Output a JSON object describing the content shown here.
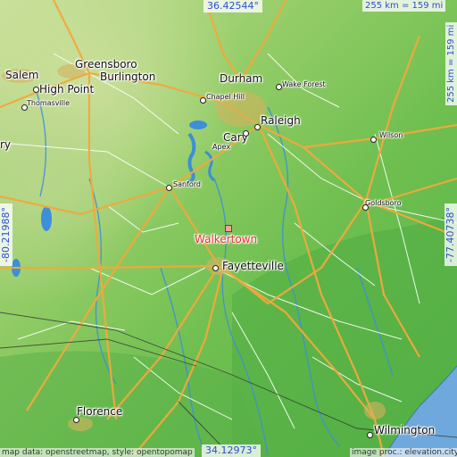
{
  "map": {
    "target": {
      "name": "Walkertown",
      "color": "#e8322a"
    },
    "coords": {
      "top": "36.42544°",
      "bottom": "34.12973°",
      "left": "-80.21988°",
      "right": "-77.40738°"
    },
    "scale": {
      "horizontal": "255 km = 159 mi",
      "vertical": "255 km = 159 mi"
    },
    "attribution": {
      "left": "map data: openstreetmap, style: opentopomap",
      "right": "image proc.: elevation.city"
    },
    "cities": [
      {
        "name": "Salem",
        "size": "big"
      },
      {
        "name": "Greensboro",
        "size": "big"
      },
      {
        "name": "High Point",
        "size": "big"
      },
      {
        "name": "Burlington",
        "size": "big"
      },
      {
        "name": "Thomasville",
        "size": "small"
      },
      {
        "name": "Durham",
        "size": "big"
      },
      {
        "name": "Wake Forest",
        "size": "small"
      },
      {
        "name": "Chapel Hill",
        "size": "small"
      },
      {
        "name": "Raleigh",
        "size": "big"
      },
      {
        "name": "Cary",
        "size": "big"
      },
      {
        "name": "Apex",
        "size": "small"
      },
      {
        "name": "Wilson",
        "size": "small"
      },
      {
        "name": "Sanford",
        "size": "small"
      },
      {
        "name": "Goldsboro",
        "size": "small"
      },
      {
        "name": "Fayetteville",
        "size": "big"
      },
      {
        "name": "Florence",
        "size": "big"
      },
      {
        "name": "Wilmington",
        "size": "big"
      },
      {
        "name": "ry",
        "size": "big"
      }
    ],
    "colors": {
      "lowland": "#6cbf4c",
      "highland": "#b9d98a",
      "water": "#3c8fd8",
      "ocean": "#6fa8dc",
      "road_major": "#f2a93b",
      "road_minor": "#ffffff"
    }
  }
}
